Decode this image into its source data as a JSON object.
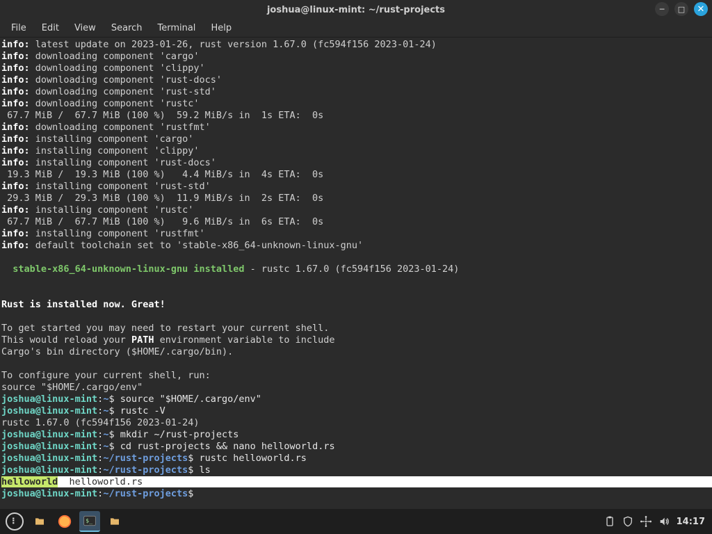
{
  "titlebar": {
    "title": "joshua@linux-mint: ~/rust-projects"
  },
  "menus": {
    "file": "File",
    "edit": "Edit",
    "view": "View",
    "search": "Search",
    "terminal": "Terminal",
    "help": "Help"
  },
  "info_label": "info:",
  "lines": {
    "l1": " latest update on 2023-01-26, rust version 1.67.0 (fc594f156 2023-01-24)",
    "l2": " downloading component 'cargo'",
    "l3": " downloading component 'clippy'",
    "l4": " downloading component 'rust-docs'",
    "l5": " downloading component 'rust-std'",
    "l6": " downloading component 'rustc'",
    "p1": " 67.7 MiB /  67.7 MiB (100 %)  59.2 MiB/s in  1s ETA:  0s",
    "l7": " downloading component 'rustfmt'",
    "l8": " installing component 'cargo'",
    "l9": " installing component 'clippy'",
    "l10": " installing component 'rust-docs'",
    "p2": " 19.3 MiB /  19.3 MiB (100 %)   4.4 MiB/s in  4s ETA:  0s",
    "l11": " installing component 'rust-std'",
    "p3": " 29.3 MiB /  29.3 MiB (100 %)  11.9 MiB/s in  2s ETA:  0s",
    "l12": " installing component 'rustc'",
    "p4": " 67.7 MiB /  67.7 MiB (100 %)   9.6 MiB/s in  6s ETA:  0s",
    "l13": " installing component 'rustfmt'",
    "l14": " default toolchain set to 'stable-x86_64-unknown-linux-gnu'",
    "stable": "  stable-x86_64-unknown-linux-gnu installed",
    "stable_suffix": " - rustc 1.67.0 (fc594f156 2023-01-24)",
    "installed": "Rust is installed now. Great!",
    "restart1": "To get started you may need to restart your current shell.",
    "restart2a": "This would reload your ",
    "restart2b": "PATH",
    "restart2c": " environment variable to include",
    "restart3": "Cargo's bin directory ($HOME/.cargo/bin).",
    "config1": "To configure your current shell, run:",
    "config2": "source \"$HOME/.cargo/env\""
  },
  "prompts": {
    "user": "joshua@linux-mint",
    "home": "~",
    "proj": "~/rust-projects",
    "dollar": "$"
  },
  "cmds": {
    "c1": " source \"$HOME/.cargo/env\"",
    "c2": " rustc -V",
    "c2out": "rustc 1.67.0 (fc594f156 2023-01-24)",
    "c3": " mkdir ~/rust-projects",
    "c4": " cd rust-projects && nano helloworld.rs",
    "c5": " rustc helloworld.rs",
    "c6": " ls",
    "ls1": "helloworld",
    "ls2": "  helloworld.rs",
    "lspad": "                                                                                                                "
  },
  "panel": {
    "clock": "14:17"
  }
}
